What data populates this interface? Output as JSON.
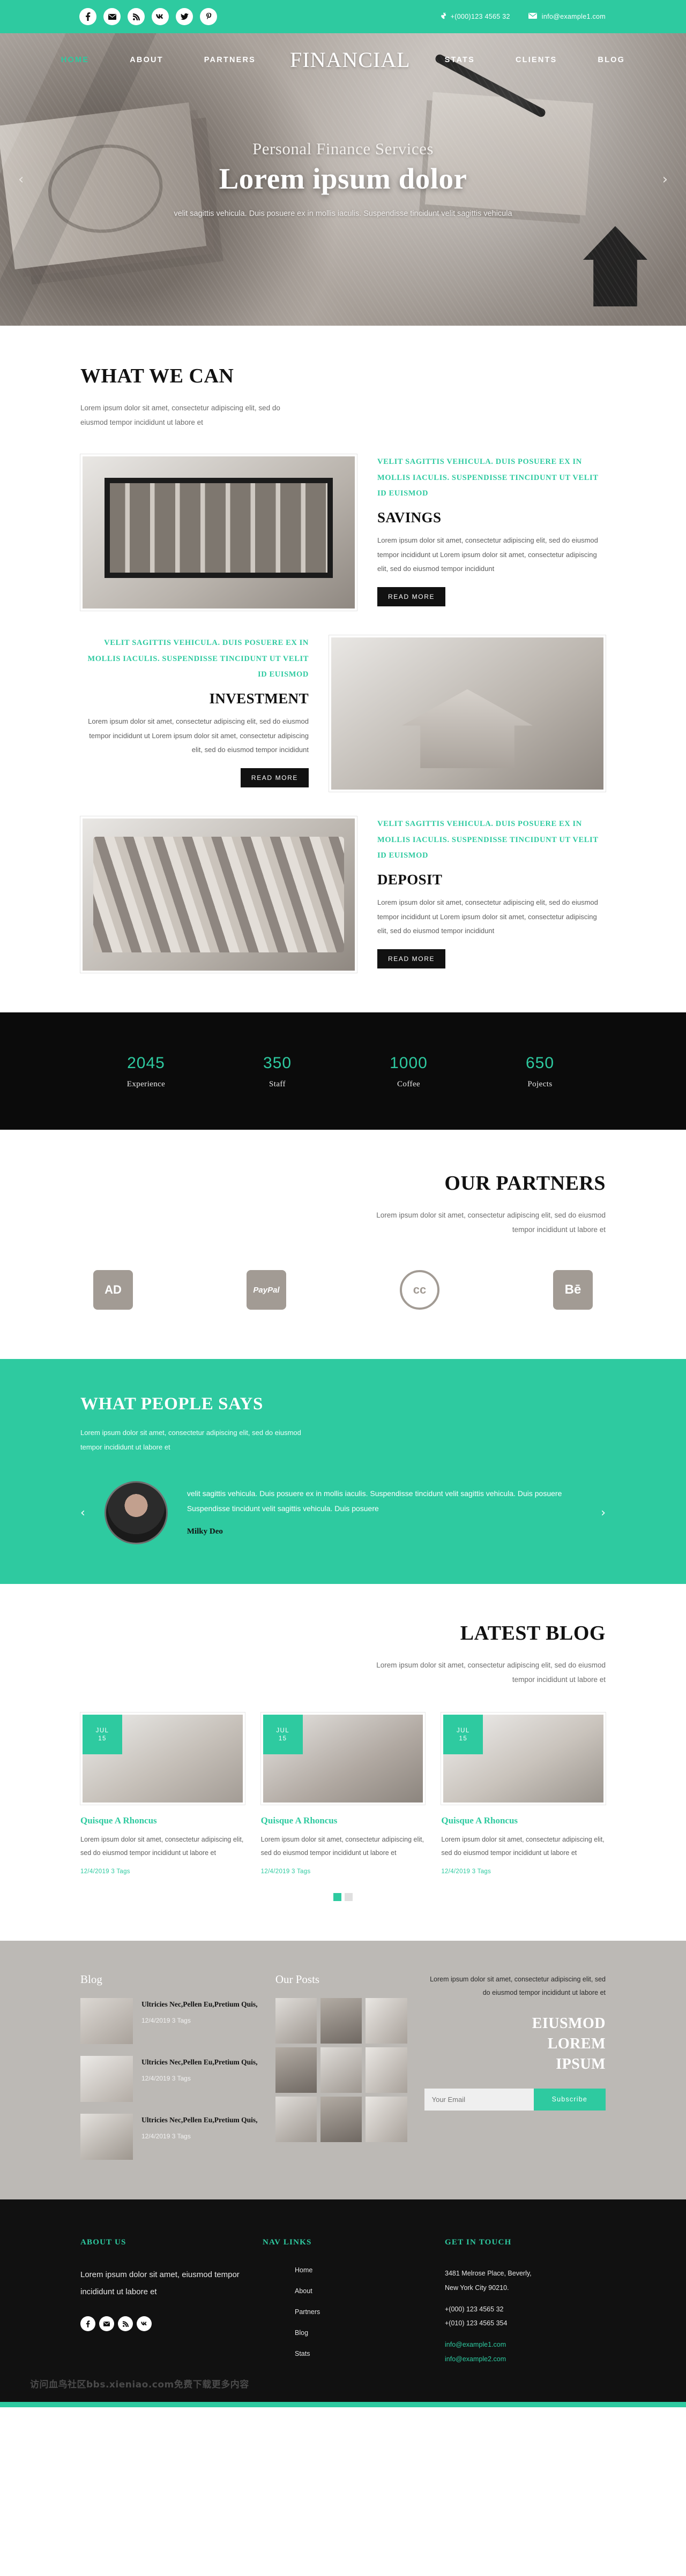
{
  "topbar": {
    "social": [
      {
        "name": "facebook-icon",
        "glyph": "f"
      },
      {
        "name": "envelope-icon",
        "glyph": "✉"
      },
      {
        "name": "rss-icon",
        "glyph": "≋"
      },
      {
        "name": "vk-icon",
        "glyph": "W"
      },
      {
        "name": "twitter-icon",
        "glyph": "ᵗ"
      },
      {
        "name": "pinterest-icon",
        "glyph": "P"
      }
    ],
    "phone": "+(000)123 4565 32",
    "email": "info@example1.com"
  },
  "nav": {
    "brand": "FINANCIAL",
    "left": [
      {
        "label": "HOME",
        "active": true
      },
      {
        "label": "ABOUT",
        "active": false
      },
      {
        "label": "PARTNERS",
        "active": false
      }
    ],
    "right": [
      {
        "label": "STATS",
        "active": false
      },
      {
        "label": "CLIENTS",
        "active": false
      },
      {
        "label": "BLOG",
        "active": false
      }
    ]
  },
  "hero": {
    "subtitle": "Personal Finance Services",
    "title": "Lorem ipsum dolor",
    "text": "velit sagittis vehicula. Duis posuere ex in mollis iaculis. Suspendisse tincidunt velit sagittis vehicula",
    "prev": "‹",
    "next": "›"
  },
  "whatwecan": {
    "title": "WHAT WE CAN",
    "lead": "Lorem ipsum dolor sit amet, consectetur adipiscing elit, sed do eiusmod tempor incididunt ut labore et",
    "items": [
      {
        "kicker": "VELIT SAGITTIS VEHICULA. DUIS POSUERE EX IN MOLLIS IACULIS. SUSPENDISSE TINCIDUNT UT VELIT ID EUISMOD",
        "heading": "SAVINGS",
        "body": "Lorem ipsum dolor sit amet, consectetur adipiscing elit, sed do eiusmod tempor incididunt ut Lorem ipsum dolor sit amet, consectetur adipiscing elit, sed do eiusmod tempor incididunt",
        "button": "READ MORE"
      },
      {
        "kicker": "VELIT SAGITTIS VEHICULA. DUIS POSUERE EX IN MOLLIS IACULIS. SUSPENDISSE TINCIDUNT UT VELIT ID EUISMOD",
        "heading": "INVESTMENT",
        "body": "Lorem ipsum dolor sit amet, consectetur adipiscing elit, sed do eiusmod tempor incididunt ut Lorem ipsum dolor sit amet, consectetur adipiscing elit, sed do eiusmod tempor incididunt",
        "button": "READ MORE"
      },
      {
        "kicker": "VELIT SAGITTIS VEHICULA. DUIS POSUERE EX IN MOLLIS IACULIS. SUSPENDISSE TINCIDUNT UT VELIT ID EUISMOD",
        "heading": "DEPOSIT",
        "body": "Lorem ipsum dolor sit amet, consectetur adipiscing elit, sed do eiusmod tempor incididunt ut Lorem ipsum dolor sit amet, consectetur adipiscing elit, sed do eiusmod tempor incididunt",
        "button": "READ MORE"
      }
    ]
  },
  "stats": [
    {
      "number": "2045",
      "label": "Experience"
    },
    {
      "number": "350",
      "label": "Staff"
    },
    {
      "number": "1000",
      "label": "Coffee"
    },
    {
      "number": "650",
      "label": "Pojects"
    }
  ],
  "partners": {
    "title": "OUR PARTNERS",
    "lead": "Lorem ipsum dolor sit amet, consectetur adipiscing elit, sed do eiusmod tempor incididunt ut labore et",
    "logos": [
      {
        "name": "adobe-logo",
        "label": "AD"
      },
      {
        "name": "paypal-logo",
        "label": "PayPal"
      },
      {
        "name": "creative-commons-logo",
        "label": "cc"
      },
      {
        "name": "behance-logo",
        "label": "Bē"
      }
    ]
  },
  "testimonials": {
    "title": "WHAT PEOPLE SAYS",
    "lead": "Lorem ipsum dolor sit amet, consectetur adipiscing elit, sed do eiusmod tempor incididunt ut labore et",
    "quote": "velit sagittis vehicula. Duis posuere ex in mollis iaculis. Suspendisse tincidunt velit sagittis vehicula. Duis posuere Suspendisse tincidunt velit sagittis vehicula. Duis posuere",
    "author": "Milky Deo",
    "prev": "‹",
    "next": "›"
  },
  "blog": {
    "title": "LATEST BLOG",
    "lead": "Lorem ipsum dolor sit amet, consectetur adipiscing elit, sed do eiusmod tempor incididunt ut labore et",
    "posts": [
      {
        "month": "JUL",
        "day": "15",
        "title": "Quisque A Rhoncus",
        "excerpt": "Lorem ipsum dolor sit amet, consectetur adipiscing elit, sed do eiusmod tempor incididunt ut labore et",
        "meta": "12/4/2019  3 Tags"
      },
      {
        "month": "JUL",
        "day": "15",
        "title": "Quisque A Rhoncus",
        "excerpt": "Lorem ipsum dolor sit amet, consectetur adipiscing elit, sed do eiusmod tempor incididunt ut labore et",
        "meta": "12/4/2019  3 Tags"
      },
      {
        "month": "JUL",
        "day": "15",
        "title": "Quisque A Rhoncus",
        "excerpt": "Lorem ipsum dolor sit amet, consectetur adipiscing elit, sed do eiusmod tempor incididunt ut labore et",
        "meta": "12/4/2019  3 Tags"
      }
    ]
  },
  "greyfooter": {
    "blog_title": "Blog",
    "posts_title": "Our Posts",
    "blog_items": [
      {
        "title": "Ultricies Nec,Pellen Eu,Pretium Quis,",
        "meta": "12/4/2019  3 Tags"
      },
      {
        "title": "Ultricies Nec,Pellen Eu,Pretium Quis,",
        "meta": "12/4/2019  3 Tags"
      },
      {
        "title": "Ultricies Nec,Pellen Eu,Pretium Quis,",
        "meta": "12/4/2019  3 Tags"
      }
    ],
    "lead": "Lorem ipsum dolor sit amet, consectetur adipiscing elit, sed do eiusmod tempor incididunt ut labore et",
    "bigwords": [
      "EIUSMOD",
      "LOREM",
      "IPSUM"
    ],
    "email_placeholder": "Your Email",
    "subscribe": "Subscribe"
  },
  "darkfooter": {
    "about_title": "ABOUT US",
    "about_text": "Lorem ipsum dolor sit amet, eiusmod tempor incididunt ut labore et",
    "social": [
      {
        "name": "facebook-icon",
        "glyph": "f"
      },
      {
        "name": "envelope-icon",
        "glyph": "✉"
      },
      {
        "name": "rss-icon",
        "glyph": "≋"
      },
      {
        "name": "vk-icon",
        "glyph": "W"
      }
    ],
    "nav_title": "NAV LINKS",
    "nav_links": [
      "Home",
      "About",
      "Partners",
      "Blog",
      "Stats"
    ],
    "touch_title": "GET IN TOUCH",
    "address_line1": "3481 Melrose Place, Beverly,",
    "address_line2": "New York City 90210.",
    "phone1": "+(000) 123 4565 32",
    "phone2": "+(010) 123 4565 354",
    "email1": "info@example1.com",
    "email2": "info@example2.com",
    "watermark": "访问血鸟社区bbs.xieniao.com免费下载更多内容"
  },
  "colors": {
    "accent": "#2ecaa0",
    "dark": "#111111",
    "grey": "#bcb9b5"
  }
}
